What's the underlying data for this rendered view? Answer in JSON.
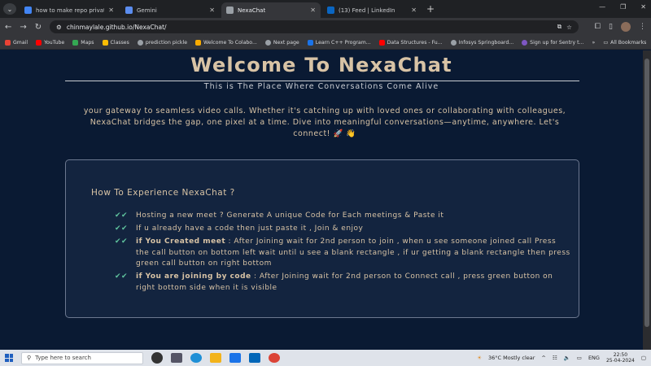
{
  "browser": {
    "tabs": [
      {
        "title": "how to make repo private in gi",
        "favicon_color": "#4285f4",
        "active": false
      },
      {
        "title": "Gemini",
        "favicon_color": "#5b8def",
        "active": false
      },
      {
        "title": "NexaChat",
        "favicon_color": "#9aa0a6",
        "active": true
      },
      {
        "title": "(13) Feed | LinkedIn",
        "favicon_color": "#0a66c2",
        "active": false
      }
    ],
    "url": "chinmaylale.github.io/NexaChat/",
    "bookmarks": [
      {
        "label": "Gmail",
        "color": "#ea4335"
      },
      {
        "label": "YouTube",
        "color": "#ff0000"
      },
      {
        "label": "Maps",
        "color": "#34a853"
      },
      {
        "label": "Classes",
        "color": "#fbbc04"
      },
      {
        "label": "prediction pickle",
        "color": "#9aa0a6"
      },
      {
        "label": "Welcome To Colabo...",
        "color": "#f9ab00"
      },
      {
        "label": "Next page",
        "color": "#9aa0a6"
      },
      {
        "label": "Learn C++ Program...",
        "color": "#1a73e8"
      },
      {
        "label": "Data Structures - Fu...",
        "color": "#ff0000"
      },
      {
        "label": "Infosys Springboard...",
        "color": "#9aa0a6"
      },
      {
        "label": "Sign up for Sentry t...",
        "color": "#7e57c2"
      }
    ],
    "all_bookmarks": "All Bookmarks"
  },
  "page": {
    "title": "Welcome To NexaChat",
    "subtitle": "This is The Place Where Conversations Come Alive",
    "intro": "your gateway to seamless video calls. Whether it's catching up with loved ones or collaborating with colleagues, NexaChat bridges the gap, one pixel at a time. Dive into meaningful conversations—anytime, anywhere. Let's connect! 🚀 👋",
    "card": {
      "title": "How To Experience NexaChat ?",
      "steps": [
        {
          "bold": "",
          "text": "Hosting a new meet ? Generate A unique Code for Each meetings & Paste it"
        },
        {
          "bold": "",
          "text": "If u already have a code then just paste it , Join & enjoy"
        },
        {
          "bold": "if You Created meet",
          "text": " : After Joining wait for 2nd person to join , when u see someone joined call Press the call button on bottom left wait until u see a blank rectangle , if ur getting a blank rectangle then press green call button on right bottom"
        },
        {
          "bold": "if You are joining by code",
          "text": " : After Joining wait for 2nd person to Connect call , press green button on right bottom side when it is visible"
        }
      ]
    }
  },
  "taskbar": {
    "search_placeholder": "Type here to search",
    "weather": "36°C  Mostly clear",
    "lang": "ENG",
    "time": "22:50",
    "date": "25-04-2024"
  },
  "colors": {
    "page_bg": "#0a1a33",
    "card_bg": "#13243f",
    "accent_text": "#d8c3a5",
    "check": "#5fc39d"
  }
}
